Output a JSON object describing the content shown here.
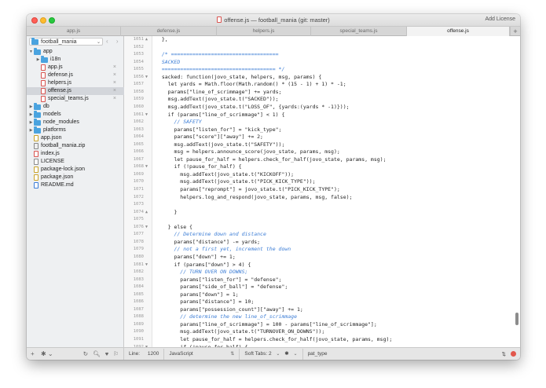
{
  "window": {
    "title": "offense.js — football_mania (git: master)",
    "license_link": "Add License"
  },
  "tabs": [
    {
      "label": "app.js",
      "active": false
    },
    {
      "label": "defense.js",
      "active": false
    },
    {
      "label": "helpers.js",
      "active": false
    },
    {
      "label": "special_teams.js",
      "active": false
    },
    {
      "label": "offense.js",
      "active": true
    }
  ],
  "tab_add_label": "+",
  "sidebar": {
    "project": "football_mania",
    "project_chevron": "⌄",
    "nav_arrows": "‹ ›",
    "tree": [
      {
        "label": "app",
        "type": "folder",
        "depth": 0,
        "expanded": true
      },
      {
        "label": "i18n",
        "type": "folder",
        "depth": 1,
        "expanded": false
      },
      {
        "label": "app.js",
        "type": "js",
        "depth": 1,
        "close": true
      },
      {
        "label": "defense.js",
        "type": "js",
        "depth": 1,
        "close": true
      },
      {
        "label": "helpers.js",
        "type": "js",
        "depth": 1,
        "close": true
      },
      {
        "label": "offense.js",
        "type": "js",
        "depth": 1,
        "close": true,
        "selected": true
      },
      {
        "label": "special_teams.js",
        "type": "js",
        "depth": 1,
        "close": true
      },
      {
        "label": "db",
        "type": "folder",
        "depth": 0,
        "expanded": false
      },
      {
        "label": "models",
        "type": "folder",
        "depth": 0,
        "expanded": false
      },
      {
        "label": "node_modules",
        "type": "folder",
        "depth": 0,
        "expanded": false
      },
      {
        "label": "platforms",
        "type": "folder",
        "depth": 0,
        "expanded": false
      },
      {
        "label": "app.json",
        "type": "json",
        "depth": 0
      },
      {
        "label": "football_mania.zip",
        "type": "zip",
        "depth": 0
      },
      {
        "label": "index.js",
        "type": "js",
        "depth": 0
      },
      {
        "label": "LICENSE",
        "type": "lic",
        "depth": 0
      },
      {
        "label": "package-lock.json",
        "type": "json",
        "depth": 0
      },
      {
        "label": "package.json",
        "type": "json",
        "depth": 0
      },
      {
        "label": "README.md",
        "type": "md",
        "depth": 0
      }
    ],
    "footer": {
      "add": "+",
      "gear": "✱ ⌄",
      "right_icons": "↻ 🔍︎ ♥ ⚐"
    }
  },
  "editor": {
    "lines": [
      {
        "n": "1051",
        "fold": "▲",
        "text": "  },",
        "comment": false
      },
      {
        "n": "1052",
        "fold": "",
        "text": "",
        "comment": false
      },
      {
        "n": "1053",
        "fold": "",
        "text": "  /* ===================================",
        "comment": true
      },
      {
        "n": "1054",
        "fold": "",
        "text": "  SACKED",
        "comment": true
      },
      {
        "n": "1055",
        "fold": "",
        "text": "  ===================================== */",
        "comment": true
      },
      {
        "n": "1056",
        "fold": "▼",
        "text": "  sacked: function(jovo_state, helpers, msg, params) {",
        "comment": false
      },
      {
        "n": "1057",
        "fold": "",
        "text": "    let yards = Math.floor(Math.random() * (15 - 1) + 1) * -1;",
        "comment": false
      },
      {
        "n": "1058",
        "fold": "",
        "text": "    params[\"line_of_scrimmage\"] += yards;",
        "comment": false
      },
      {
        "n": "1059",
        "fold": "",
        "text": "    msg.addText(jovo_state.t(\"SACKED\"));",
        "comment": false
      },
      {
        "n": "1060",
        "fold": "",
        "text": "    msg.addText(jovo_state.t(\"LOSS_OF\", {yards:(yards * -1)}));",
        "comment": false
      },
      {
        "n": "1061",
        "fold": "▼",
        "text": "    if (params[\"line_of_scrimmage\"] < 1) {",
        "comment": false
      },
      {
        "n": "1062",
        "fold": "",
        "text": "      // SAFETY",
        "comment": true
      },
      {
        "n": "1063",
        "fold": "",
        "text": "      params[\"listen_for\"] = \"kick_type\";",
        "comment": false
      },
      {
        "n": "1064",
        "fold": "",
        "text": "      params[\"score\"][\"away\"] += 2;",
        "comment": false
      },
      {
        "n": "1065",
        "fold": "",
        "text": "      msg.addText(jovo_state.t(\"SAFETY\"));",
        "comment": false
      },
      {
        "n": "1066",
        "fold": "",
        "text": "      msg = helpers.announce_score(jovo_state, params, msg);",
        "comment": false
      },
      {
        "n": "1067",
        "fold": "",
        "text": "      let pause_for_half = helpers.check_for_half(jovo_state, params, msg);",
        "comment": false
      },
      {
        "n": "1068",
        "fold": "▼",
        "text": "      if (!pause_for_half) {",
        "comment": false
      },
      {
        "n": "1069",
        "fold": "",
        "text": "        msg.addText(jovo_state.t(\"KICKOFF\"));",
        "comment": false
      },
      {
        "n": "1070",
        "fold": "",
        "text": "        msg.addText(jovo_state.t(\"PICK_KICK_TYPE\"));",
        "comment": false
      },
      {
        "n": "1071",
        "fold": "",
        "text": "        params[\"reprompt\"] = jovo_state.t(\"PICK_KICK_TYPE\");",
        "comment": false
      },
      {
        "n": "1072",
        "fold": "",
        "text": "        helpers.log_and_respond(jovo_state, params, msg, false);",
        "comment": false
      },
      {
        "n": "1073",
        "fold": "",
        "text": "",
        "comment": false
      },
      {
        "n": "1074",
        "fold": "▲",
        "text": "      }",
        "comment": false
      },
      {
        "n": "1075",
        "fold": "",
        "text": "",
        "comment": false
      },
      {
        "n": "1076",
        "fold": "▼",
        "text": "    } else {",
        "comment": false
      },
      {
        "n": "1077",
        "fold": "",
        "text": "      // Determine down and distance",
        "comment": true
      },
      {
        "n": "1078",
        "fold": "",
        "text": "      params[\"distance\"] -= yards;",
        "comment": false
      },
      {
        "n": "1079",
        "fold": "",
        "text": "      // not a first yet, increment the down",
        "comment": true
      },
      {
        "n": "1080",
        "fold": "",
        "text": "      params[\"down\"] += 1;",
        "comment": false
      },
      {
        "n": "1081",
        "fold": "▼",
        "text": "      if (params[\"down\"] > 4) {",
        "comment": false
      },
      {
        "n": "1082",
        "fold": "",
        "text": "        // TURN OVER ON DOWNS;",
        "comment": true
      },
      {
        "n": "1083",
        "fold": "",
        "text": "        params[\"listen_for\"] = \"defense\";",
        "comment": false
      },
      {
        "n": "1084",
        "fold": "",
        "text": "        params[\"side_of_ball\"] = \"defense\";",
        "comment": false
      },
      {
        "n": "1085",
        "fold": "",
        "text": "        params[\"down\"] = 1;",
        "comment": false
      },
      {
        "n": "1086",
        "fold": "",
        "text": "        params[\"distance\"] = 10;",
        "comment": false
      },
      {
        "n": "1087",
        "fold": "",
        "text": "        params[\"possession_count\"][\"away\"] += 1;",
        "comment": false
      },
      {
        "n": "1088",
        "fold": "",
        "text": "        // determine the new line_of_scrimmage",
        "comment": true
      },
      {
        "n": "1089",
        "fold": "",
        "text": "        params[\"line_of_scrimmage\"] = 100 - params[\"line_of_scrimmage\"];",
        "comment": false
      },
      {
        "n": "1090",
        "fold": "",
        "text": "        msg.addText(jovo_state.t(\"TURNOVER_ON_DOWNS\"));",
        "comment": false
      },
      {
        "n": "1091",
        "fold": "",
        "text": "        let pause_for_half = helpers.check_for_half(jovo_state, params, msg);",
        "comment": false
      },
      {
        "n": "1092",
        "fold": "▼",
        "text": "        if (!pause_for_half) {",
        "comment": false
      },
      {
        "n": "1093",
        "fold": "",
        "text": "          msg.addText(jovo_state.t(\"OPP_TAKE_OVER\"));",
        "comment": false
      },
      {
        "n": "1094",
        "fold": "▼",
        "text": "          if (params[\"line_of_scrimmage\"] > 50) {",
        "comment": false
      },
      {
        "n": "1095",
        "fold": "",
        "text": "            // on opps side of the ball",
        "comment": true
      },
      {
        "n": "1096",
        "fold": "",
        "text": "            msg.addText(jovo_state.t(\"OPP_OWN_YARD\", {yard_mark:(100 - params[\"line_of_scrimmage\"])}));",
        "comment": false
      },
      {
        "n": "1097",
        "fold": "",
        "text": "",
        "comment": false
      }
    ]
  },
  "status": {
    "line_label": "Line:",
    "line_value": "1200",
    "language": "JavaScript",
    "soft_tabs": "Soft Tabs:  2",
    "symbol": "pat_type",
    "chevron": "⌄"
  }
}
